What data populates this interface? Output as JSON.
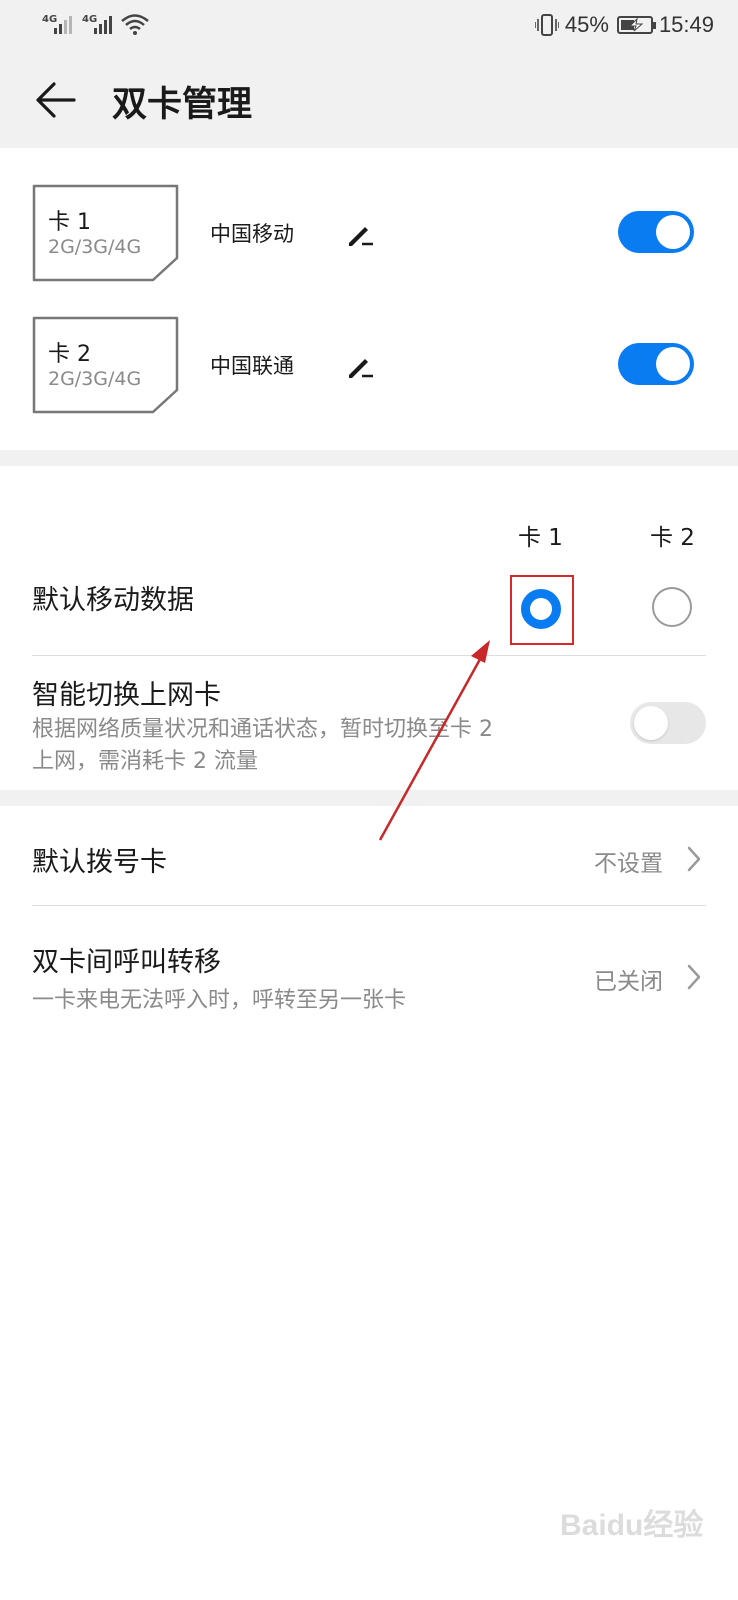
{
  "status_bar": {
    "signal_1_tag": "4G",
    "signal_2_tag": "4G",
    "battery_percent": "45%",
    "battery_level": 0.45,
    "time": "15:49",
    "icons": [
      "signal-icon",
      "wifi-icon",
      "vibrate-icon",
      "battery-icon"
    ]
  },
  "header": {
    "title": "双卡管理"
  },
  "sim_cards": [
    {
      "name": "卡 1",
      "network": "2G/3G/4G",
      "carrier": "中国移动",
      "enabled": true
    },
    {
      "name": "卡 2",
      "network": "2G/3G/4G",
      "carrier": "中国联通",
      "enabled": true
    }
  ],
  "default_data": {
    "col_1": "卡 1",
    "col_2": "卡 2",
    "label": "默认移动数据",
    "selected": "卡 1"
  },
  "smart_switch": {
    "title": "智能切换上网卡",
    "desc_1": "根据网络质量状况和通话状态，暂时切换至卡 2",
    "desc_2": "上网，需消耗卡 2 流量",
    "enabled": false
  },
  "default_dial": {
    "label": "默认拨号卡",
    "value": "不设置"
  },
  "call_forward": {
    "title": "双卡间呼叫转移",
    "desc": "一卡来电无法呼入时，呼转至另一张卡",
    "value": "已关闭"
  },
  "colors": {
    "accent": "#0a7cf2",
    "highlight": "#d42a2a",
    "header_bg": "#f1f1f1"
  },
  "watermark": "Baidu经验"
}
